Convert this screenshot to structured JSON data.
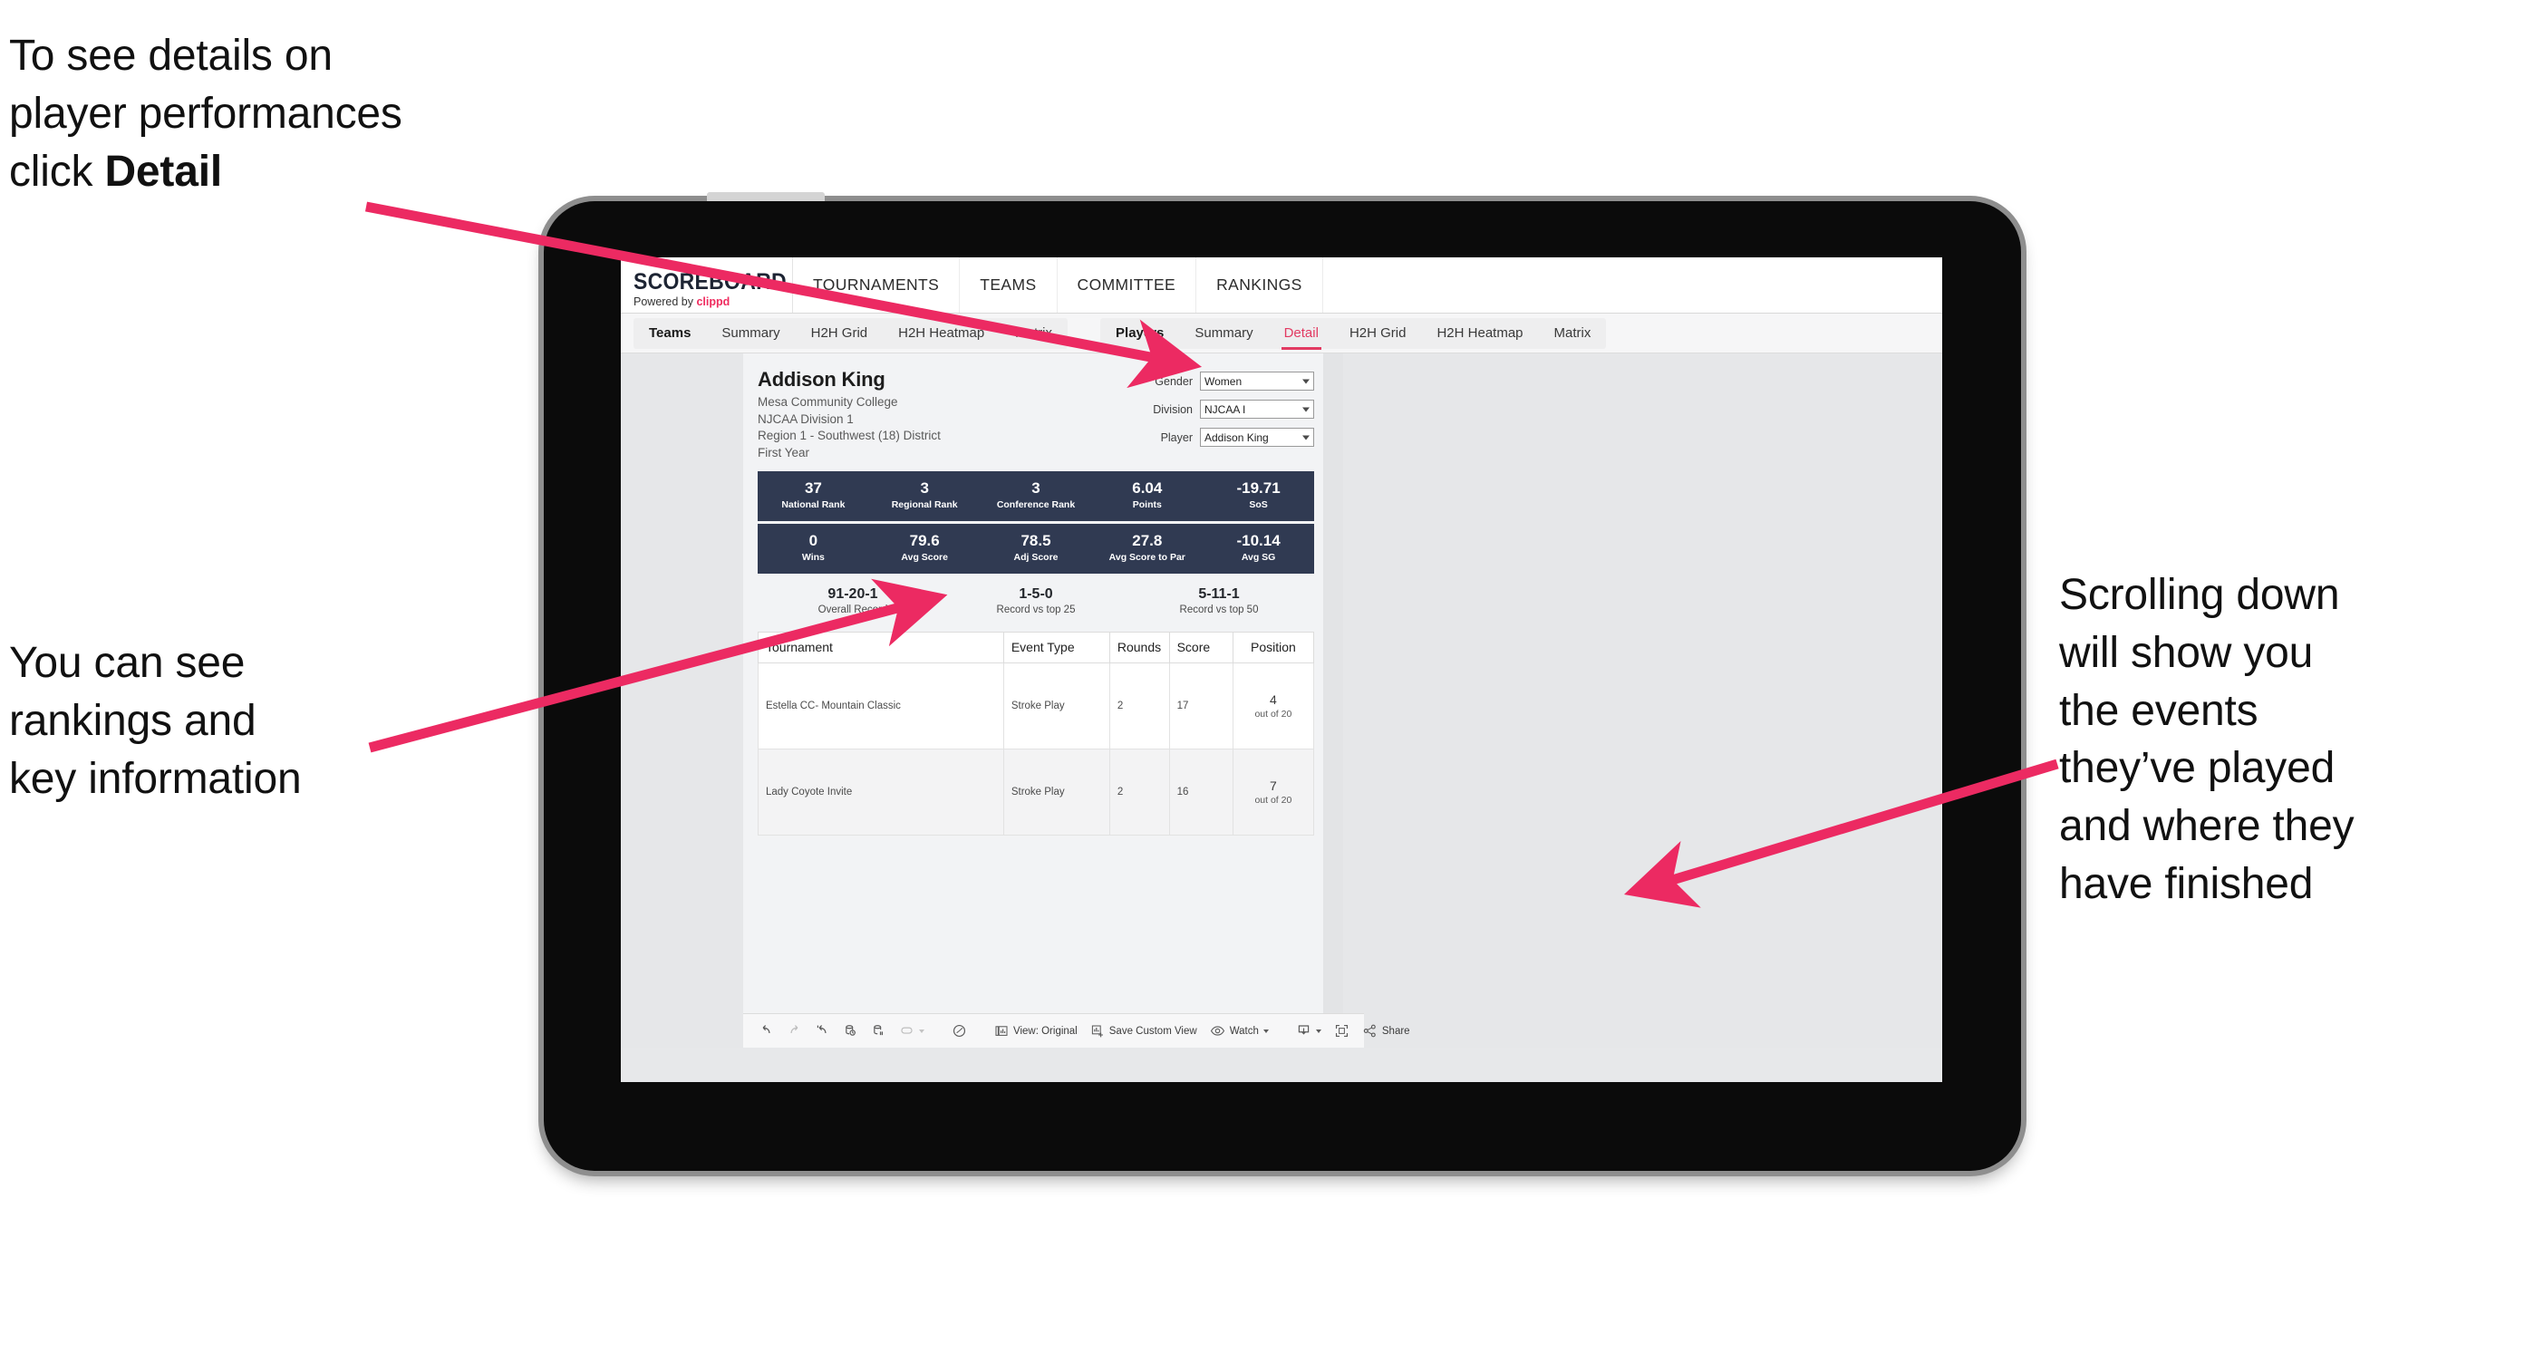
{
  "annotations": {
    "top_left": "To see details on\nplayer performances\nclick ",
    "top_left_bold": "Detail",
    "mid_left": "You can see\nrankings and\nkey information",
    "right": "Scrolling down\nwill show you\nthe events\nthey’ve played\nand where they\nhave finished",
    "arrow_color": "#ec2a62"
  },
  "app": {
    "logo": {
      "word": "SCOREBOARD",
      "powered_prefix": "Powered by ",
      "brand": "clippd"
    },
    "top_nav": [
      "TOURNAMENTS",
      "TEAMS",
      "COMMITTEE",
      "RANKINGS"
    ],
    "sub_nav": {
      "group_teams": [
        "Teams",
        "Summary",
        "H2H Grid",
        "H2H Heatmap",
        "Matrix"
      ],
      "group_players": [
        "Players",
        "Summary",
        "Detail",
        "H2H Grid",
        "H2H Heatmap",
        "Matrix"
      ],
      "active_tab": "Detail"
    }
  },
  "player": {
    "name": "Addison King",
    "school": "Mesa Community College",
    "division": "NJCAA Division 1",
    "region": "Region 1 - Southwest (18) District",
    "year": "First Year"
  },
  "filters": [
    {
      "label": "Gender",
      "value": "Women"
    },
    {
      "label": "Division",
      "value": "NJCAA I"
    },
    {
      "label": "Player",
      "value": "Addison King"
    }
  ],
  "stats_row_1": [
    {
      "value": "37",
      "label": "National Rank"
    },
    {
      "value": "3",
      "label": "Regional Rank"
    },
    {
      "value": "3",
      "label": "Conference Rank"
    },
    {
      "value": "6.04",
      "label": "Points"
    },
    {
      "value": "-19.71",
      "label": "SoS"
    }
  ],
  "stats_row_2": [
    {
      "value": "0",
      "label": "Wins"
    },
    {
      "value": "79.6",
      "label": "Avg Score"
    },
    {
      "value": "78.5",
      "label": "Adj Score"
    },
    {
      "value": "27.8",
      "label": "Avg Score to Par"
    },
    {
      "value": "-10.14",
      "label": "Avg SG"
    }
  ],
  "records": [
    {
      "value": "91-20-1",
      "label": "Overall Record"
    },
    {
      "value": "1-5-0",
      "label": "Record vs top 25"
    },
    {
      "value": "5-11-1",
      "label": "Record vs top 50"
    }
  ],
  "table": {
    "headers": [
      "Tournament",
      "Event Type",
      "Rounds",
      "Score",
      "Position"
    ],
    "rows": [
      {
        "tournament": "Estella CC- Mountain Classic",
        "event_type": "Stroke Play",
        "rounds": "2",
        "score": "17",
        "position_num": "4",
        "position_of": "out of 20"
      },
      {
        "tournament": "Lady Coyote Invite",
        "event_type": "Stroke Play",
        "rounds": "2",
        "score": "16",
        "position_num": "7",
        "position_of": "out of 20"
      }
    ]
  },
  "toolbar": {
    "view_label": "View: Original",
    "save_label": "Save Custom View",
    "watch_label": "Watch",
    "share_label": "Share"
  },
  "colors": {
    "accent_pink": "#e23a62",
    "stat_navy": "#303a52",
    "viz_bg": "#e6e7e9",
    "card_bg": "#f2f3f5"
  }
}
